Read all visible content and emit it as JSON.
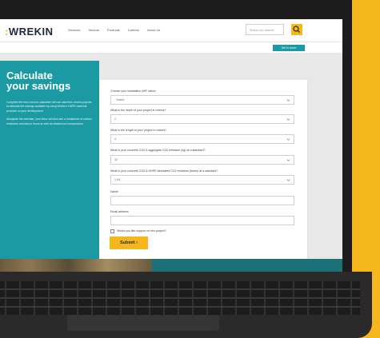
{
  "header": {
    "logo_prefix": ":",
    "logo_text": "WREKIN",
    "nav": [
      "Services",
      "Sectors",
      "Products",
      "Careers",
      "About Us"
    ],
    "search_placeholder": "Search our website",
    "contact_label": "Get in touch"
  },
  "panel": {
    "title_line1": "Calculate",
    "title_line2": "your savings",
    "paragraph1": "Complete the form and our calculator will use data from recent projects to estimate the savings available by using Wrekin's HDPE manhole products on your development.",
    "paragraph2": "Alongside the estimate, your inbox will also see a breakdown of carbon, emissions and labour hours as well as related cost comparisons."
  },
  "form": {
    "fields": [
      {
        "label": "Choose your installation (MP value)",
        "value": "- Select -"
      },
      {
        "label": "What is the depth of your project in metres?",
        "value": "2"
      },
      {
        "label": "What is the length of your project in metres?",
        "value": "4"
      },
      {
        "label": "What is your concrete CO2 & aggregate CO2 emission (kg) at a standard?",
        "value": "32"
      },
      {
        "label": "What is your concrete CO2 & HDPE fabricated CO2 emission (tonne) at a standard?",
        "value": "1.05"
      },
      {
        "label": "Name",
        "value": ""
      },
      {
        "label": "Email address",
        "value": ""
      }
    ],
    "checkbox_label": "Would you like support on this project?",
    "submit_label": "Submit ›"
  },
  "colors": {
    "background": "#f5b71c",
    "teal": "#1c9aa3",
    "accent_yellow": "#f5b71c"
  }
}
